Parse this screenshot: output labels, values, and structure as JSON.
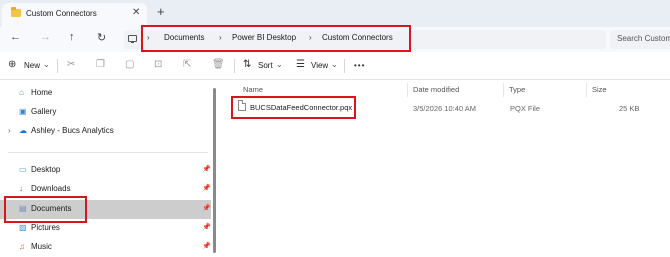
{
  "window": {
    "tab_title": "Custom Connectors",
    "tab_close_glyph": "✕",
    "new_tab_glyph": "+"
  },
  "navigation": {
    "back_glyph": "←",
    "forward_glyph": "→",
    "up_glyph": "↑",
    "refresh_glyph": "↻",
    "separator_glyph": "›",
    "breadcrumbs": [
      "Documents",
      "Power BI Desktop",
      "Custom Connectors"
    ],
    "search_placeholder": "Search Custom"
  },
  "commandbar": {
    "new_label": "New",
    "new_icon_glyph": "⊕",
    "sort_label": "Sort",
    "sort_icon_glyph": "⇅",
    "view_label": "View",
    "view_icon_glyph": "☰",
    "dropdown_glyph": "⌄",
    "more_glyph": "•••",
    "disabled_icons": [
      "cut-icon",
      "copy-icon",
      "paste-icon",
      "rename-icon",
      "share-icon",
      "delete-icon"
    ]
  },
  "sidebar": {
    "items": [
      {
        "label": "Home",
        "icon": "home-icon",
        "glyph": "⌂",
        "color": "#5a7fb5"
      },
      {
        "label": "Gallery",
        "icon": "gallery-icon",
        "glyph": "▣",
        "color": "#2f86d4"
      },
      {
        "label": "Ashley - Bucs Analytics",
        "icon": "onedrive-icon",
        "glyph": "☁",
        "color": "#1f6fd1",
        "chevron": "›"
      },
      {
        "label": "Desktop",
        "icon": "desktop-icon",
        "glyph": "▭",
        "color": "#3a8fd6",
        "pin": "📌"
      },
      {
        "label": "Downloads",
        "icon": "downloads-icon",
        "glyph": "↓",
        "color": "#2e8b57",
        "pin": "📌"
      },
      {
        "label": "Documents",
        "icon": "documents-icon",
        "glyph": "▤",
        "color": "#6b8cc4",
        "pin": "📌",
        "selected": true
      },
      {
        "label": "Pictures",
        "icon": "pictures-icon",
        "glyph": "▨",
        "color": "#3a8fd6",
        "pin": "📌"
      },
      {
        "label": "Music",
        "icon": "music-icon",
        "glyph": "♫",
        "color": "#e2583e",
        "pin": "📌"
      }
    ]
  },
  "filelist": {
    "columns": [
      "Name",
      "Date modified",
      "Type",
      "Size"
    ],
    "rows": [
      {
        "name": "BUCSDataFeedConnector.pqx",
        "date": "3/5/2026 10:40 AM",
        "type": "PQX File",
        "size": "25 KB"
      }
    ]
  },
  "colors": {
    "highlight": "#d9161e",
    "selected_bg": "#cdcdcd",
    "tabstrip_bg": "#e9eef5"
  }
}
